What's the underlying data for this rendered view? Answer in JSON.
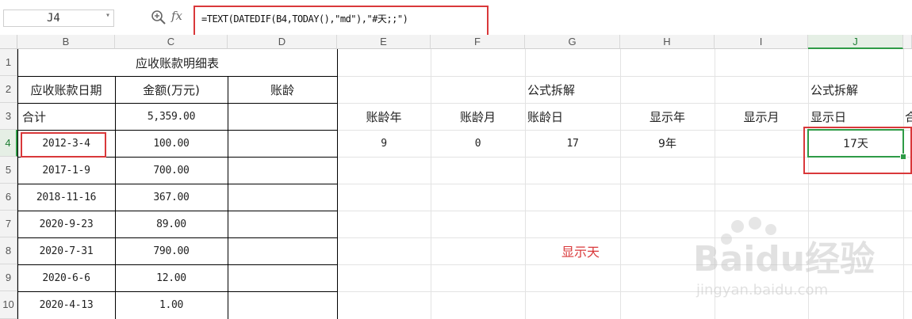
{
  "formula_bar": {
    "name_box": "J4",
    "formula": "=TEXT(DATEDIF(B4,TODAY(),\"md\"),\"#天;;\")",
    "icons": [
      "zoom-icon",
      "fx-icon"
    ],
    "fx_label": "fx"
  },
  "columns": [
    "B",
    "C",
    "D",
    "E",
    "F",
    "G",
    "H",
    "I",
    "J"
  ],
  "rows": [
    "1",
    "2",
    "3",
    "4",
    "5",
    "6",
    "7",
    "8",
    "9",
    "10"
  ],
  "table": {
    "title": "应收账款明细表",
    "headers": [
      "应收账款日期",
      "金额(万元)",
      "账龄"
    ],
    "total_label": "合计",
    "total_amount": "5,359.00",
    "records": [
      {
        "date": "2012-3-4",
        "amount": "100.00"
      },
      {
        "date": "2017-1-9",
        "amount": "700.00"
      },
      {
        "date": "2018-11-16",
        "amount": "367.00"
      },
      {
        "date": "2020-9-23",
        "amount": "89.00"
      },
      {
        "date": "2020-7-31",
        "amount": "790.00"
      },
      {
        "date": "2020-6-6",
        "amount": "12.00"
      },
      {
        "date": "2020-4-13",
        "amount": "1.00"
      }
    ]
  },
  "breakdown": {
    "title_g": "公式拆解",
    "title_j": "公式拆解",
    "headers": [
      "账龄年",
      "账龄月",
      "账龄日",
      "显示年",
      "显示月",
      "显示日",
      "合"
    ],
    "values": {
      "years": "9",
      "months": "0",
      "days": "17",
      "show_year": "9年",
      "show_day": "17天"
    },
    "annotation": "显示天"
  },
  "watermark": {
    "brand": "Baidu经验",
    "url": "jingyan.baidu.com"
  },
  "colors": {
    "highlight_red": "#d9383a",
    "active_green": "#2e9b46"
  }
}
